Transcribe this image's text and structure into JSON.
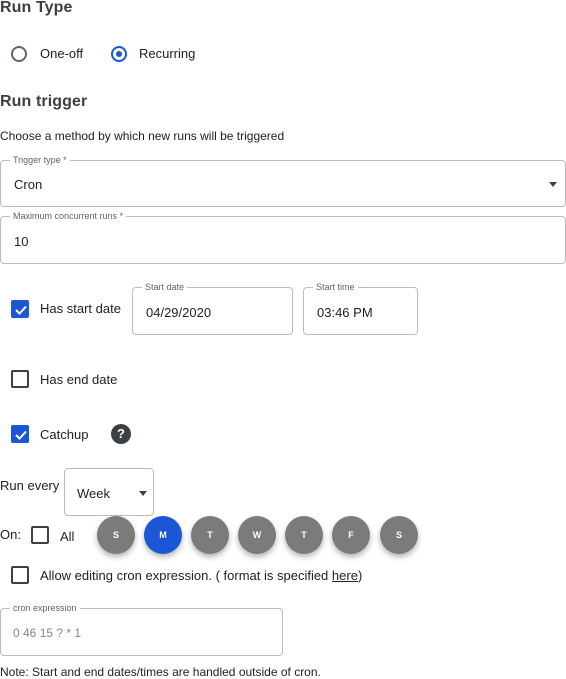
{
  "run_type": {
    "heading": "Run Type",
    "options": [
      {
        "label": "One-off",
        "selected": false
      },
      {
        "label": "Recurring",
        "selected": true
      }
    ]
  },
  "run_trigger": {
    "heading": "Run trigger",
    "description": "Choose a method by which new runs will be triggered",
    "trigger_type": {
      "label": "Trigger type *",
      "value": "Cron"
    },
    "max_concurrent": {
      "label": "Maximum concurrent runs *",
      "value": "10"
    },
    "has_start_date": {
      "label": "Has start date",
      "checked": true
    },
    "start_date": {
      "label": "Start date",
      "value": "04/29/2020"
    },
    "start_time": {
      "label": "Start time",
      "value": "03:46 PM"
    },
    "has_end_date": {
      "label": "Has end date",
      "checked": false
    },
    "catchup": {
      "label": "Catchup",
      "checked": true,
      "help_icon": "help-icon"
    },
    "run_every": {
      "label": "Run every",
      "value": "Week"
    },
    "on": {
      "label": "On:",
      "all_label": "All",
      "all_checked": false,
      "days": [
        {
          "label": "S",
          "selected": false
        },
        {
          "label": "M",
          "selected": true
        },
        {
          "label": "T",
          "selected": false
        },
        {
          "label": "W",
          "selected": false
        },
        {
          "label": "T",
          "selected": false
        },
        {
          "label": "F",
          "selected": false
        },
        {
          "label": "S",
          "selected": false
        }
      ]
    },
    "allow_edit": {
      "label": "Allow editing cron expression. ( format is specified ",
      "link": "here",
      "suffix": ")",
      "checked": false
    },
    "cron": {
      "label": "cron expression",
      "value": "0 46 15 ? * 1"
    },
    "note": "Note: Start and end dates/times are handled outside of cron."
  },
  "colors": {
    "accent": "#1a56d6",
    "day_inactive": "#7b7b7b"
  }
}
